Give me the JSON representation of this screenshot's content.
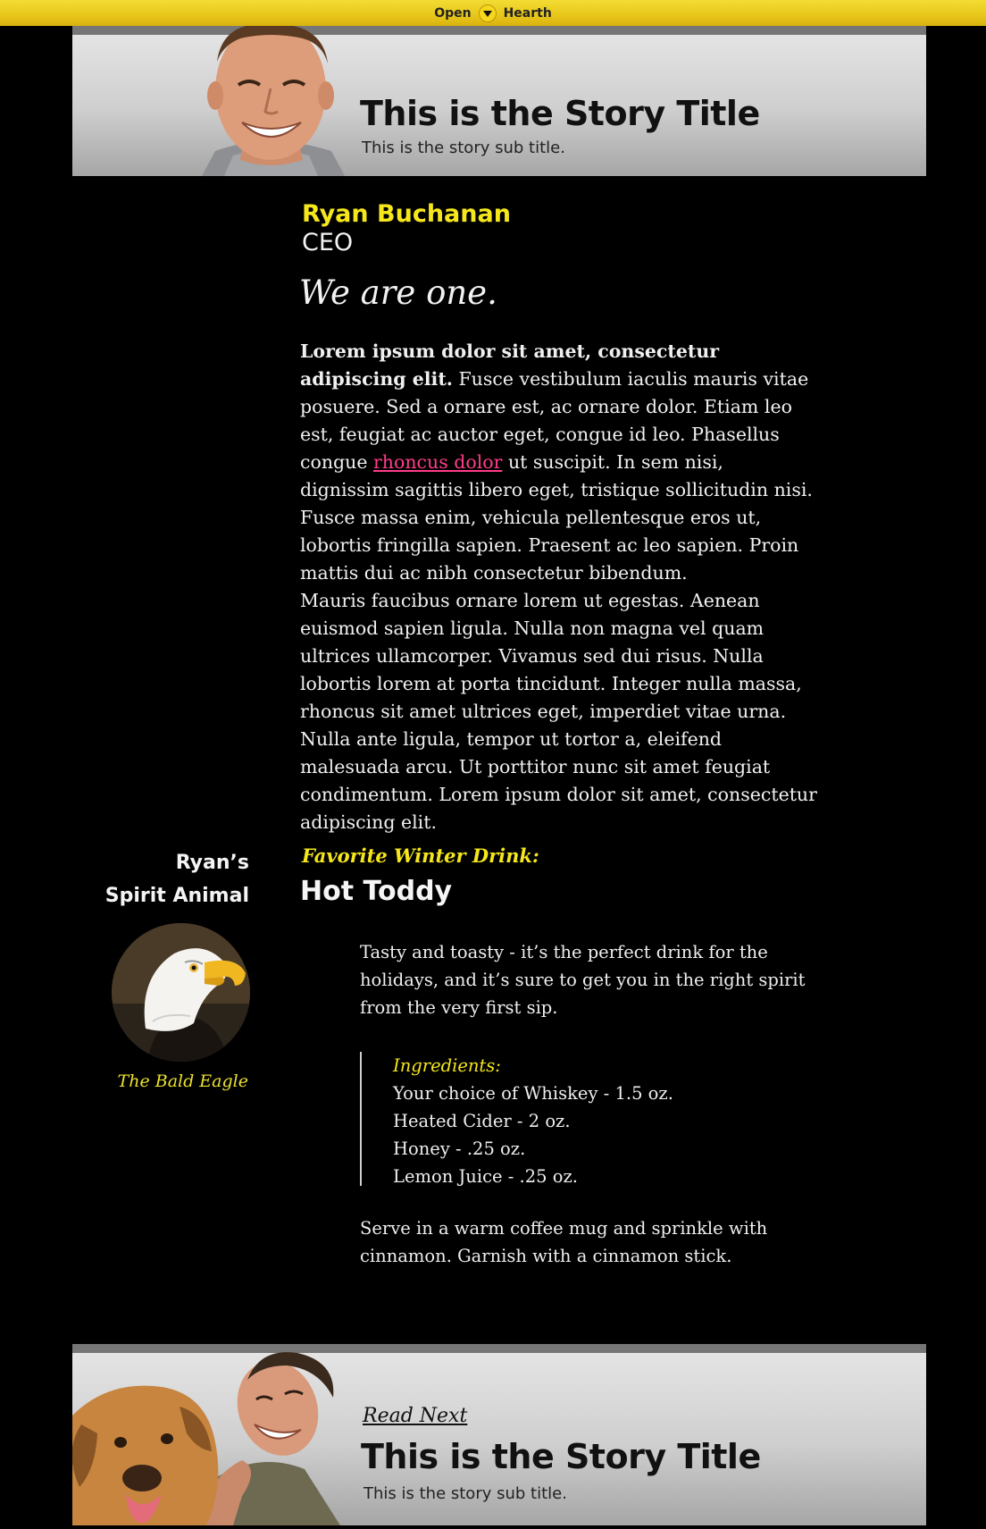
{
  "topbar": {
    "left": "Open",
    "right": "Hearth"
  },
  "hero_top": {
    "title": "This is the Story Title",
    "subtitle": "This is the story sub title."
  },
  "person": {
    "name": "Ryan Buchanan",
    "role": "CEO",
    "tagline": "We are one."
  },
  "article": {
    "p1_bold": "Lorem ipsum dolor sit amet, consectetur adipiscing elit.",
    "p1_before_link": " Fusce vestibulum iaculis mauris vitae posuere. Sed a ornare est, ac ornare dolor. Etiam leo est, feugiat ac auctor eget, congue id leo. Phasellus congue ",
    "p1_link": "rhoncus dolor",
    "p1_after_link": " ut suscipit. In sem nisi, dignissim sagittis libero eget, tristique sollicitudin nisi. Fusce massa enim, vehicula pellentesque eros ut, lobortis fringilla sapien. Praesent ac leo sapien. Proin mattis dui ac nibh consectetur bibendum.",
    "p2": "Mauris faucibus ornare lorem ut egestas. Aenean euismod sapien ligula. Nulla non magna vel quam ultrices ullamcorper. Vivamus sed dui risus. Nulla lobortis lorem at porta tincidunt. Integer nulla massa, rhoncus sit amet ultrices eget, imperdiet vitae urna. Nulla ante ligula, tempor ut tortor a, eleifend malesuada arcu. Ut porttitor nunc sit amet feugiat condimentum. Lorem ipsum dolor sit amet, consectetur adipiscing elit."
  },
  "spirit": {
    "heading_line1": "Ryan’s",
    "heading_line2": "Spirit Animal",
    "caption": "The Bald Eagle",
    "image_icon": "eagle-photo"
  },
  "drink": {
    "label": "Favorite Winter Drink:",
    "name": "Hot Toddy",
    "description": "Tasty and toasty - it’s the perfect drink for the holidays, and it’s sure to get you in the right spirit from the very first sip.",
    "ingredients_label": "Ingredients:",
    "ingredients": [
      "Your choice of Whiskey - 1.5 oz.",
      "Heated Cider - 2 oz.",
      "Honey - .25 oz.",
      "Lemon Juice - .25 oz."
    ],
    "serve": "Serve in a warm coffee mug and sprinkle with cinnamon. Garnish with a cinnamon stick."
  },
  "hero_bottom": {
    "read_next": "Read Next",
    "title": "This is the Story Title",
    "subtitle": "This is the story sub title."
  },
  "colors": {
    "accent_yellow": "#f5e71b",
    "link_pink": "#ff3c8a",
    "background": "#000000"
  }
}
